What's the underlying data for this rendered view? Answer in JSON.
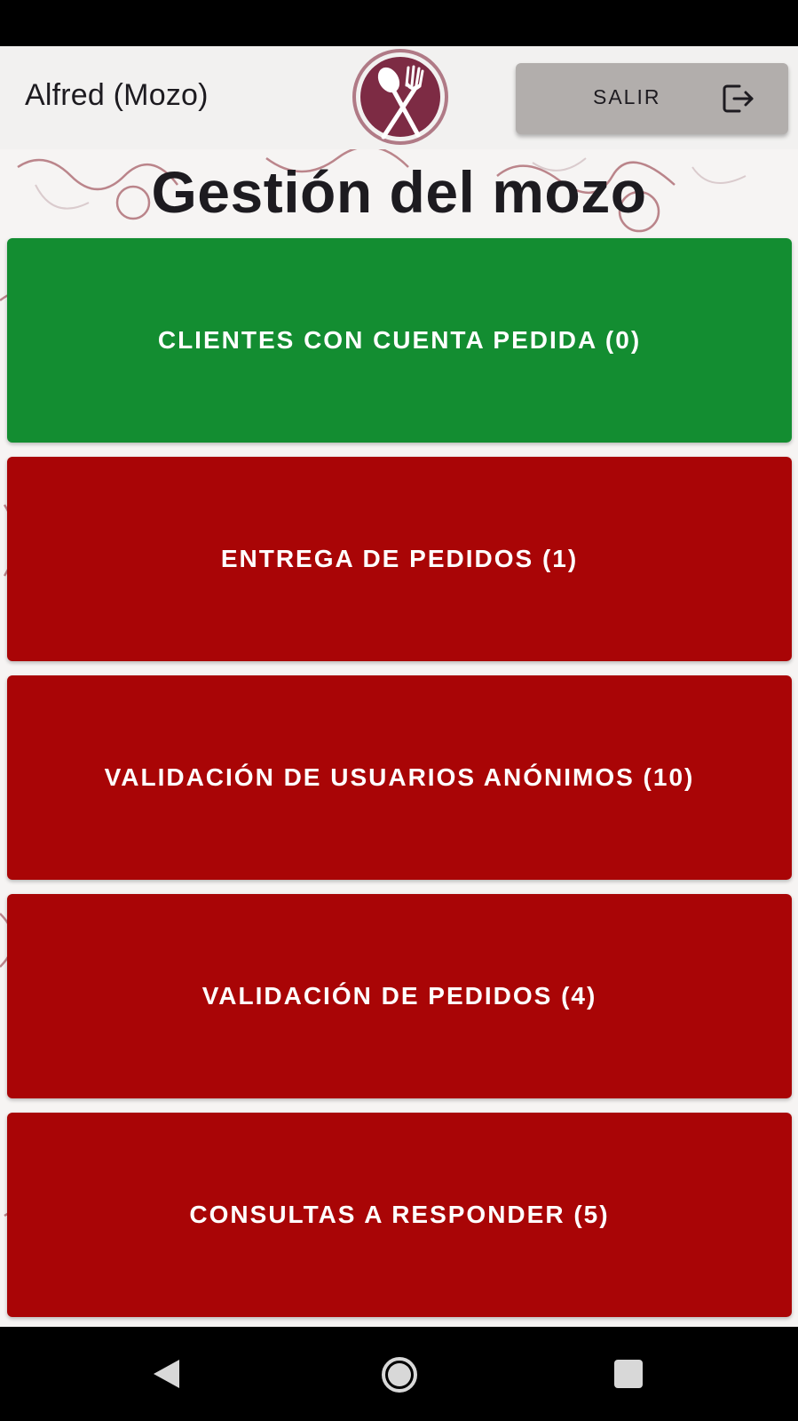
{
  "header": {
    "user_label": "Alfred (Mozo)",
    "logout_label": "SALIR"
  },
  "page": {
    "title": "Gestión del mozo"
  },
  "actions": [
    {
      "label": "CLIENTES CON CUENTA PEDIDA (0)",
      "color": "#138d31"
    },
    {
      "label": "ENTREGA DE PEDIDOS (1)",
      "color": "#a90506"
    },
    {
      "label": "VALIDACIÓN DE USUARIOS ANÓNIMOS (10)",
      "color": "#a90506"
    },
    {
      "label": "VALIDACIÓN DE PEDIDOS (4)",
      "color": "#a90506"
    },
    {
      "label": "CONSULTAS A RESPONDER (5)",
      "color": "#a90506"
    }
  ],
  "colors": {
    "brand": "#7d2b44",
    "accent_green": "#138d31",
    "accent_red": "#a90506",
    "logout_bg": "#b2aeac"
  },
  "icons": {
    "logo": "spoon-fork-logo-icon",
    "logout": "logout-icon",
    "nav_back": "back-triangle-icon",
    "nav_home": "home-circle-icon",
    "nav_recents": "recents-square-icon"
  }
}
